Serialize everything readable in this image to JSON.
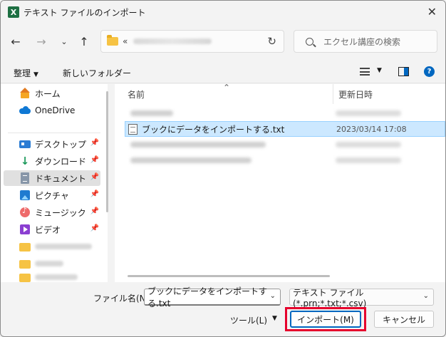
{
  "window": {
    "title": "テキスト ファイルのインポート"
  },
  "nav": {
    "address_prefix": "«",
    "search_placeholder": "エクセル講座の検索"
  },
  "toolbar": {
    "organize_label": "整理",
    "new_folder_label": "新しいフォルダー"
  },
  "sidebar": {
    "items": [
      {
        "label": "ホーム",
        "icon": "home-icon"
      },
      {
        "label": "OneDrive",
        "icon": "cloud-icon"
      },
      {
        "label": "デスクトップ",
        "icon": "desktop-icon",
        "pinned": true
      },
      {
        "label": "ダウンロード",
        "icon": "download-icon",
        "pinned": true
      },
      {
        "label": "ドキュメント",
        "icon": "documents-icon",
        "pinned": true,
        "selected": true
      },
      {
        "label": "ピクチャ",
        "icon": "pictures-icon",
        "pinned": true
      },
      {
        "label": "ミュージック",
        "icon": "music-icon",
        "pinned": true
      },
      {
        "label": "ビデオ",
        "icon": "video-icon",
        "pinned": true
      }
    ]
  },
  "filelist": {
    "col_name": "名前",
    "col_date": "更新日時",
    "files": [
      {
        "name": "ブックにデータをインポートする.txt",
        "date": "2023/03/14 17:08",
        "selected": true
      }
    ]
  },
  "bottom": {
    "filename_label": "ファイル名(N):",
    "filename_value": "ブックにデータをインポートする.txt",
    "filetype_value": "テキスト ファイル (*.prn;*.txt;*.csv)",
    "tools_label": "ツール(L)",
    "import_label": "インポート(M)",
    "cancel_label": "キャンセル"
  },
  "colors": {
    "accent": "#0067c0",
    "highlight_ring": "#e6002d",
    "selection": "#cce8ff"
  }
}
